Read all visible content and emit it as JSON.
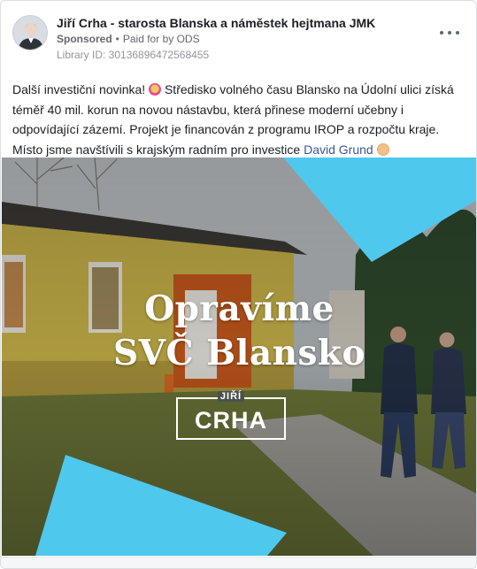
{
  "post": {
    "page_name": "Jiří Crha - starosta Blanska a náměstek hejtmana JMK",
    "sponsored_label": "Sponsored",
    "separator": "•",
    "paid_for_by": "Paid for by ODS",
    "library_id": "Library ID: 301368964725684​55",
    "body_lines": [
      "Další investiční novinka!",
      "Středisko volného času Blansko na Údolní ulici získá",
      "téměř 40 mil. korun na novou nástavbu, která přinese moderní učebny i",
      "odpovídající zázemí. Projekt je financován z programu IROP a rozpočtu kraje.",
      "Místo jsme navštívili s krajským radním pro investice"
    ],
    "mention": "David Grund",
    "icons": {
      "avatar": "profile-photo",
      "more": "more-options-icon",
      "emoji_1": "star-struck-emoji",
      "emoji_2": "waving-hand-emoji"
    }
  },
  "media": {
    "title_line_1": "Opravíme",
    "title_line_2": "SVČ Blansko",
    "logo_first_name": "JIŘÍ",
    "logo_last_name": "CRHA",
    "colors": {
      "accent_cyan": "#4fc8ee",
      "text": "#ffffff"
    }
  }
}
